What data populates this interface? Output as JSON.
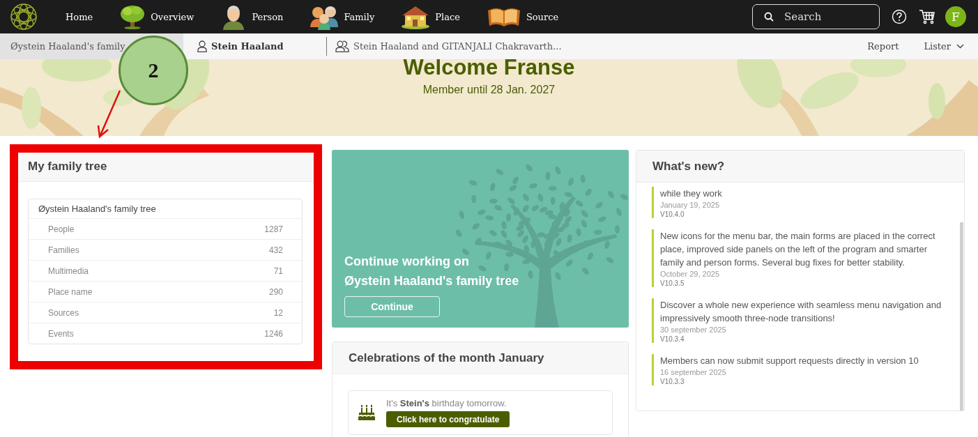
{
  "nav": {
    "items": [
      {
        "label": "Home",
        "kind": "text"
      },
      {
        "label": "Overview",
        "kind": "tree"
      },
      {
        "label": "Person",
        "kind": "person"
      },
      {
        "label": "Family",
        "kind": "family"
      },
      {
        "label": "Place",
        "kind": "house"
      },
      {
        "label": "Source",
        "kind": "book"
      }
    ],
    "search": {
      "placeholder": "Search"
    },
    "avatar": {
      "initial": "F"
    }
  },
  "context_bar": {
    "tabs": [
      {
        "label": "Øystein Haaland's family",
        "kind": "tree",
        "selected": true,
        "emphasized": false
      },
      {
        "label": "Stein Haaland",
        "kind": "person",
        "selected": false,
        "emphasized": true
      },
      {
        "label": "Stein Haaland and GITANJALI Chakravarth...",
        "kind": "couple",
        "selected": false,
        "emphasized": false
      }
    ],
    "actions": [
      {
        "label": "Report",
        "kind": "link"
      },
      {
        "label": "Lister",
        "kind": "menu"
      }
    ]
  },
  "banner": {
    "title": "Welcome Franse",
    "subtitle": "Member until 28 Jan. 2027"
  },
  "family_tree_card": {
    "title": "My family tree",
    "highlighted": true,
    "tree_name": "Øystein Haaland's family tree",
    "stats": [
      {
        "label": "People",
        "count": "1287"
      },
      {
        "label": "Families",
        "count": "432"
      },
      {
        "label": "Multimedia",
        "count": "71"
      },
      {
        "label": "Place name",
        "count": "290"
      },
      {
        "label": "Sources",
        "count": "12"
      },
      {
        "label": "Events",
        "count": "1246"
      }
    ]
  },
  "continue_card": {
    "heading_lines": [
      "Continue working on",
      "Øystein Haaland's family tree"
    ],
    "button": "Continue"
  },
  "celebrations": {
    "title": "Celebrations of the month January",
    "items": [
      {
        "text": "It's **Stein's** birthday tomorrow.",
        "button": "Click here to congratulate"
      }
    ]
  },
  "whats_new": {
    "title": "What's new?",
    "items": [
      {
        "text": "while they work",
        "date": "January 19, 2025",
        "version": "V10.4.0"
      },
      {
        "text": "New icons for the menu bar, the main forms are placed in the correct place, improved side panels on the left of the program and smarter family and person forms. Several bug fixes for better stability.",
        "date": "October 29, 2025",
        "version": "V10.3.5"
      },
      {
        "text": "Discover a whole new experience with seamless menu navigation and impressively smooth three-node transitions!",
        "date": "30 september 2025",
        "version": "V10.3.4"
      },
      {
        "text": "Members can now submit support requests directly in version 10",
        "date": "16 september 2025",
        "version": "V10.3.3"
      }
    ]
  },
  "annotation": {
    "callout": "2"
  }
}
